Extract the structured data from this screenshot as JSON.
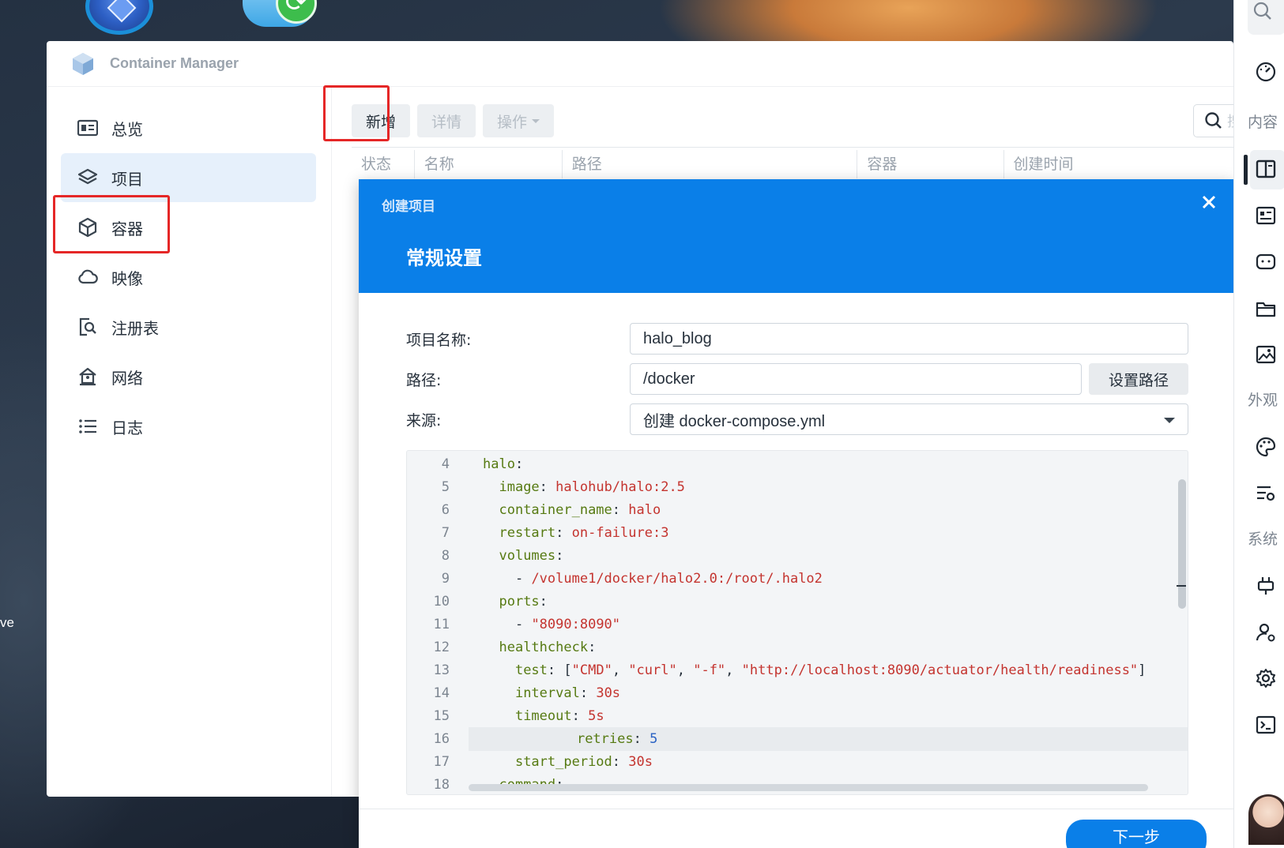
{
  "desktop": {
    "partial_label": "ve"
  },
  "window": {
    "title": "Container Manager"
  },
  "sidebar": {
    "items": [
      {
        "label": "总览",
        "icon": "overview-icon"
      },
      {
        "label": "项目",
        "icon": "layers-icon",
        "active": true
      },
      {
        "label": "容器",
        "icon": "cube-icon"
      },
      {
        "label": "映像",
        "icon": "cloud-icon"
      },
      {
        "label": "注册表",
        "icon": "registry-search-icon"
      },
      {
        "label": "网络",
        "icon": "network-house-icon"
      },
      {
        "label": "日志",
        "icon": "list-icon"
      }
    ]
  },
  "toolbar": {
    "add_label": "新增",
    "details_label": "详情",
    "actions_label": "操作",
    "search_placeholder": "搜"
  },
  "table": {
    "columns": [
      "状态",
      "名称",
      "路径",
      "容器",
      "创建时间"
    ]
  },
  "dialog": {
    "title": "创建项目",
    "section_title": "常规设置",
    "fields": {
      "name_label": "项目名称:",
      "name_value": "halo_blog",
      "path_label": "路径:",
      "path_value": "/docker",
      "set_path_label": "设置路径",
      "source_label": "来源:",
      "source_value": "创建 docker-compose.yml"
    },
    "editor_lines": [
      {
        "n": "4",
        "indent": "",
        "key": "halo",
        "rest": []
      },
      {
        "n": "5",
        "indent": "  ",
        "key": "image",
        "rest": [
          {
            "t": "v",
            "s": "halohub/halo:2.5"
          }
        ]
      },
      {
        "n": "6",
        "indent": "  ",
        "key": "container_name",
        "rest": [
          {
            "t": "v",
            "s": "halo"
          }
        ]
      },
      {
        "n": "7",
        "indent": "  ",
        "key": "restart",
        "rest": [
          {
            "t": "v",
            "s": "on-failure:3"
          }
        ]
      },
      {
        "n": "8",
        "indent": "  ",
        "key": "volumes",
        "rest": []
      },
      {
        "n": "9",
        "indent": "    ",
        "key": "",
        "rest": [
          {
            "t": "p",
            "s": "- "
          },
          {
            "t": "v",
            "s": "/volume1/docker/halo2.0:/root/.halo2"
          }
        ]
      },
      {
        "n": "10",
        "indent": "  ",
        "key": "ports",
        "rest": []
      },
      {
        "n": "11",
        "indent": "    ",
        "key": "",
        "rest": [
          {
            "t": "p",
            "s": "- "
          },
          {
            "t": "v",
            "s": "\"8090:8090\""
          }
        ]
      },
      {
        "n": "12",
        "indent": "  ",
        "key": "healthcheck",
        "rest": []
      },
      {
        "n": "13",
        "indent": "    ",
        "key": "test",
        "rest": [
          {
            "t": "p",
            "s": "["
          },
          {
            "t": "v",
            "s": "\"CMD\""
          },
          {
            "t": "p",
            "s": ", "
          },
          {
            "t": "v",
            "s": "\"curl\""
          },
          {
            "t": "p",
            "s": ", "
          },
          {
            "t": "v",
            "s": "\"-f\""
          },
          {
            "t": "p",
            "s": ", "
          },
          {
            "t": "v",
            "s": "\"http://localhost:8090/actuator/health/readiness\""
          },
          {
            "t": "p",
            "s": "]"
          }
        ]
      },
      {
        "n": "14",
        "indent": "    ",
        "key": "interval",
        "rest": [
          {
            "t": "v",
            "s": "30s"
          }
        ]
      },
      {
        "n": "15",
        "indent": "    ",
        "key": "timeout",
        "rest": [
          {
            "t": "v",
            "s": "5s"
          }
        ]
      },
      {
        "n": "16",
        "indent": "    ",
        "key": "retries",
        "rest": [
          {
            "t": "n",
            "s": "5"
          }
        ],
        "current": true
      },
      {
        "n": "17",
        "indent": "    ",
        "key": "start_period",
        "rest": [
          {
            "t": "v",
            "s": "30s"
          }
        ]
      },
      {
        "n": "18",
        "indent": "  ",
        "key": "command",
        "rest": []
      }
    ],
    "next_label": "下一步"
  },
  "rightbar": {
    "labels": {
      "content": "内容",
      "appearance": "外观",
      "system": "系统"
    },
    "icons": [
      "search-icon",
      "gauge-icon",
      "layout-icon",
      "news-icon",
      "chat-icon",
      "folder-icon",
      "image-icon",
      "palette-icon",
      "text-settings-icon",
      "plug-icon",
      "user-settings-icon",
      "gear-icon",
      "terminal-icon"
    ]
  },
  "colors": {
    "accent": "#0a7fe8",
    "highlight_box": "#e52727",
    "yaml_key": "#567a12",
    "yaml_string": "#c4342f",
    "yaml_number": "#2a62c4"
  }
}
